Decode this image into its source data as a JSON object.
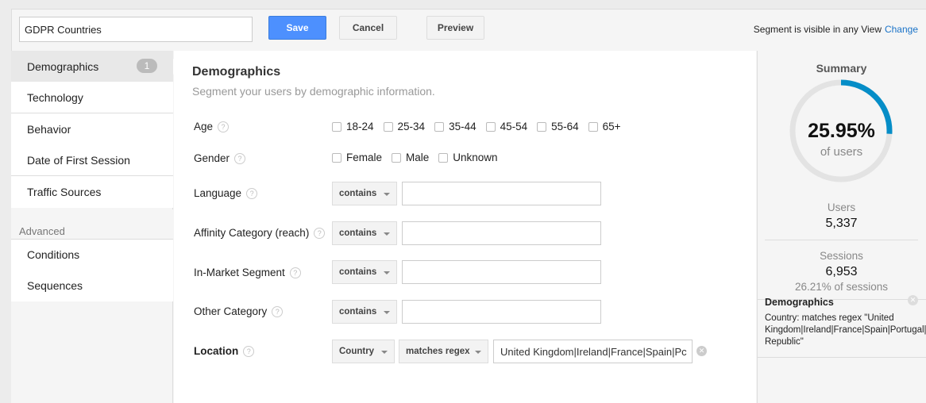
{
  "header": {
    "segment_name": "GDPR Countries",
    "save": "Save",
    "cancel": "Cancel",
    "preview": "Preview",
    "visibility": "Segment is visible in any View",
    "change": "Change"
  },
  "sidebar": {
    "items": [
      {
        "label": "Demographics",
        "badge": "1"
      },
      {
        "label": "Technology"
      },
      {
        "label": "Behavior"
      },
      {
        "label": "Date of First Session"
      },
      {
        "label": "Traffic Sources"
      }
    ],
    "advanced_label": "Advanced",
    "advanced_items": [
      {
        "label": "Conditions"
      },
      {
        "label": "Sequences"
      }
    ]
  },
  "main": {
    "title": "Demographics",
    "subtitle": "Segment your users by demographic information.",
    "age": {
      "label": "Age",
      "options": [
        "18-24",
        "25-34",
        "35-44",
        "45-54",
        "55-64",
        "65+"
      ]
    },
    "gender": {
      "label": "Gender",
      "options": [
        "Female",
        "Male",
        "Unknown"
      ]
    },
    "language": {
      "label": "Language",
      "operator": "contains",
      "value": ""
    },
    "affinity": {
      "label": "Affinity Category (reach)",
      "operator": "contains",
      "value": ""
    },
    "inmarket": {
      "label": "In-Market Segment",
      "operator": "contains",
      "value": ""
    },
    "other": {
      "label": "Other Category",
      "operator": "contains",
      "value": ""
    },
    "location": {
      "label": "Location",
      "dimension": "Country",
      "operator": "matches regex",
      "value": "United Kingdom|Ireland|France|Spain|Pc"
    },
    "help": "?"
  },
  "summary": {
    "title": "Summary",
    "percent": "25.95%",
    "percent_value": 25.95,
    "of_users": "of users",
    "users_label": "Users",
    "users": "5,337",
    "sessions_label": "Sessions",
    "sessions": "6,953",
    "sessions_pct": "26.21% of sessions",
    "accent": "#058dc7",
    "condition_title": "Demographics",
    "condition_text": "Country: matches regex \"United Kingdom|Ireland|France|Spain|Portugal|It\nRepublic\""
  }
}
